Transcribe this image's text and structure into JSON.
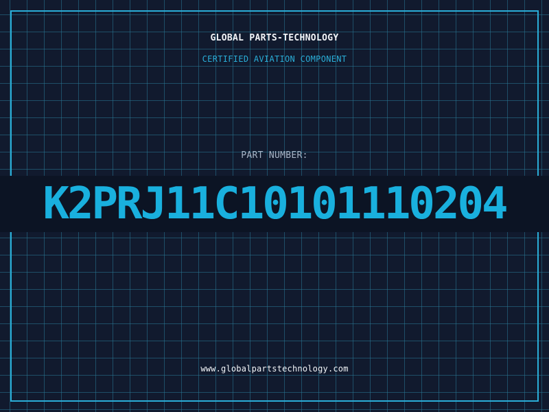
{
  "header": {
    "company_name": "GLOBAL PARTS-TECHNOLOGY",
    "subtitle": "CERTIFIED AVIATION COMPONENT"
  },
  "part": {
    "label": "PART NUMBER:",
    "number": "K2PRJ11C10101110204"
  },
  "footer": {
    "website": "www.globalpartstechnology.com"
  },
  "colors": {
    "background": "#111a2e",
    "grid": "#28789a",
    "accent": "#2aaed8",
    "band": "#0c1424",
    "text_light": "#f2f5f8",
    "text_muted": "#a9b6c8"
  }
}
